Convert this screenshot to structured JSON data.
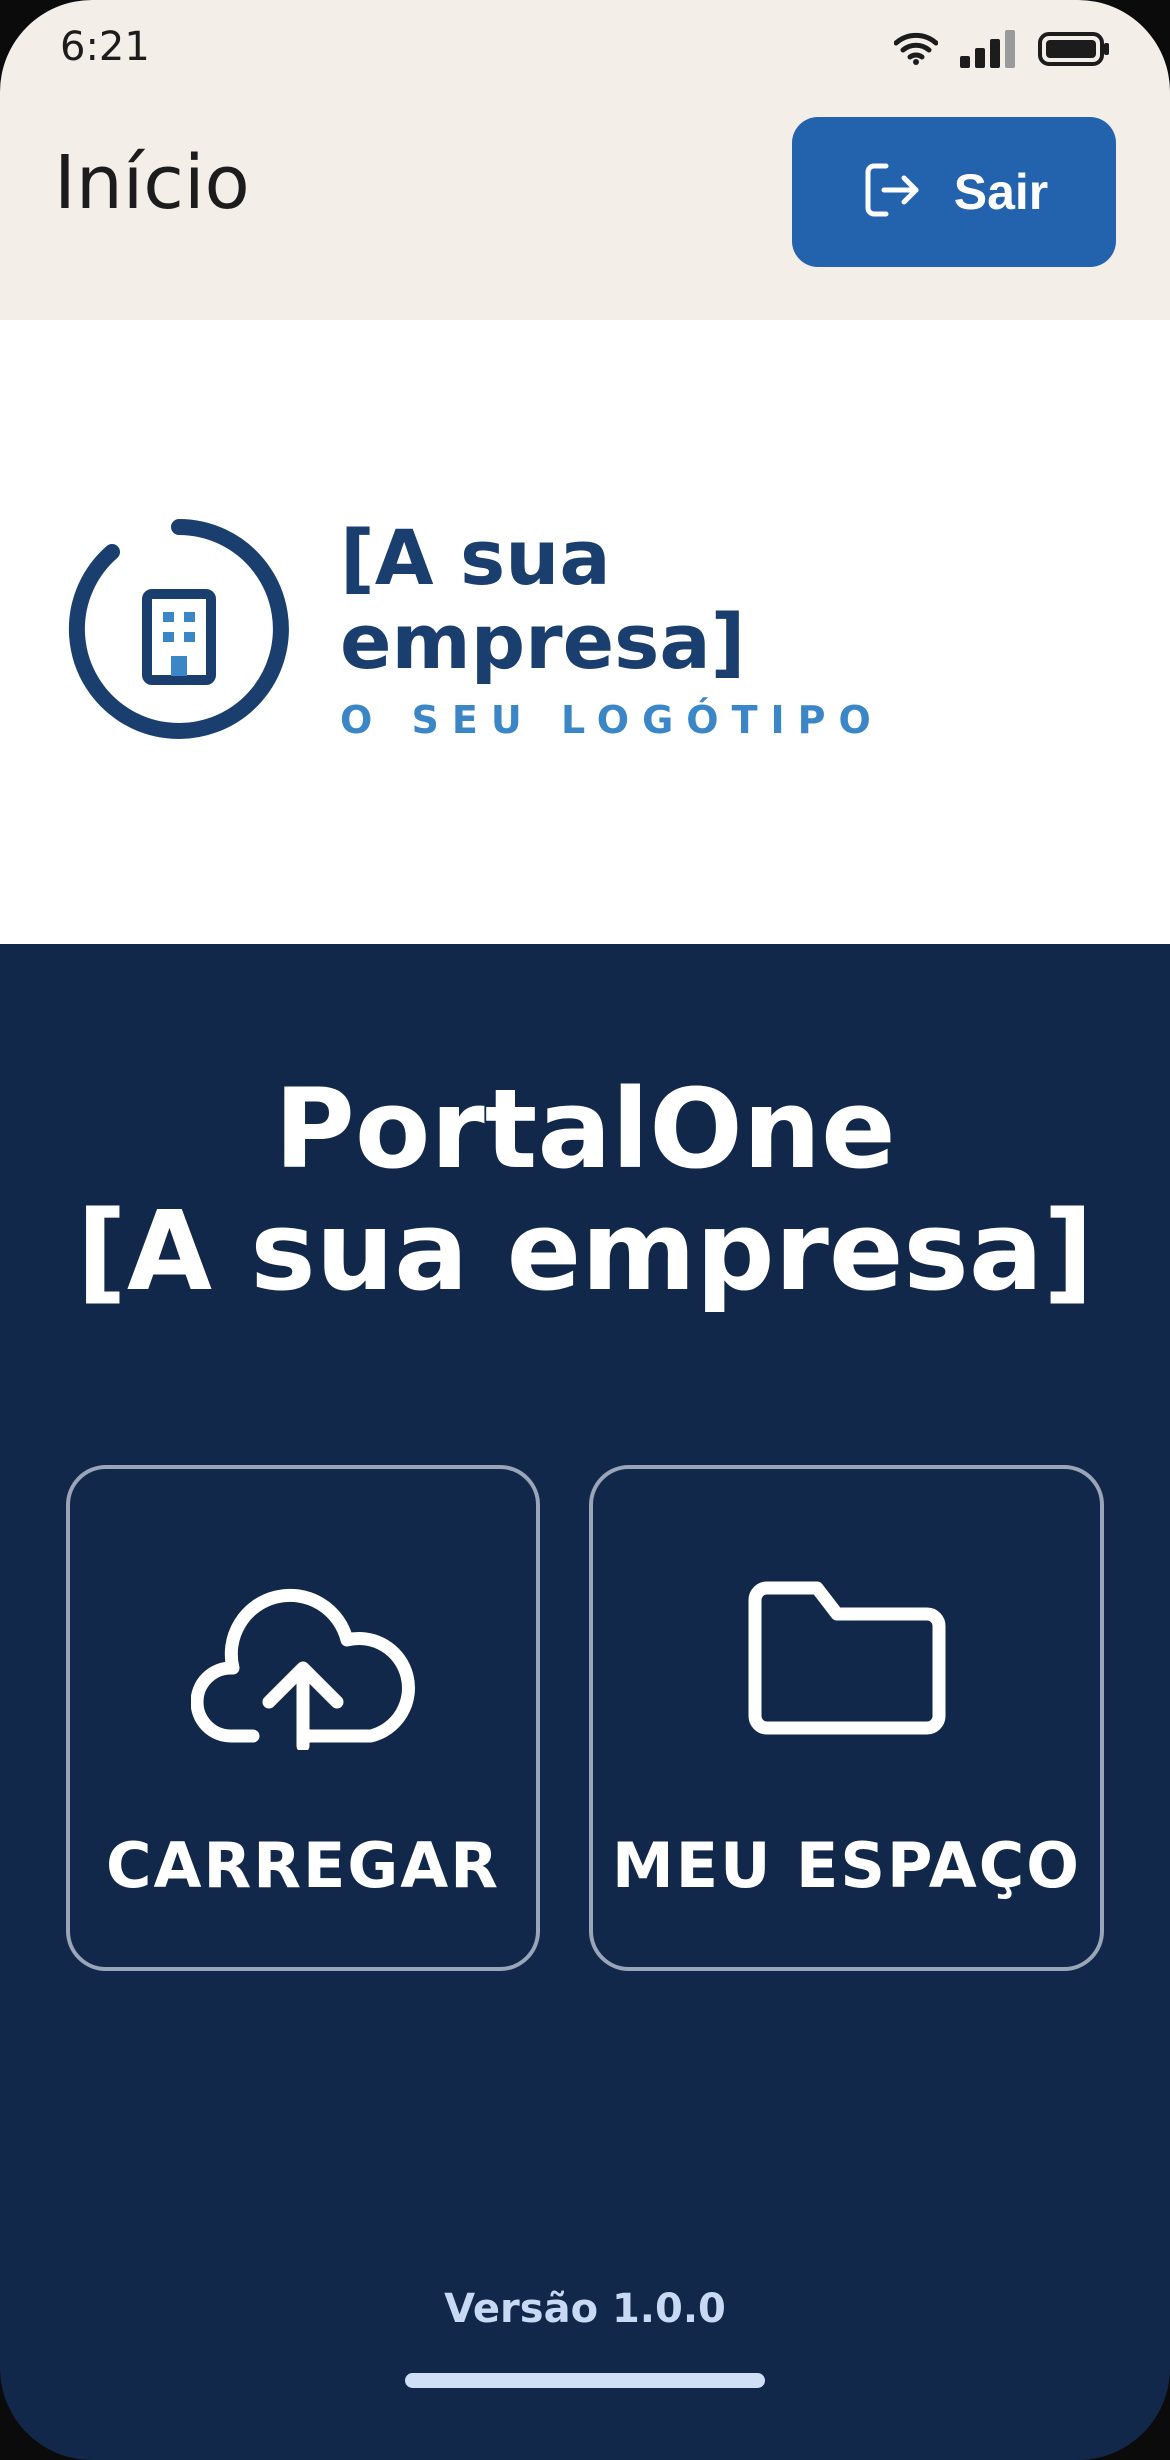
{
  "status_bar": {
    "time": "6:21",
    "icons": [
      "wifi-icon",
      "cellular-signal-icon",
      "battery-icon"
    ]
  },
  "header": {
    "title": "Início",
    "logout": {
      "label": "Sair",
      "icon": "logout-icon"
    }
  },
  "logo": {
    "company": "[A sua empresa]",
    "tagline": "O SEU LOGÓTIPO",
    "icon": "building-icon"
  },
  "main": {
    "title_line1": "PortalOne",
    "title_line2": "[A sua empresa]",
    "tiles": [
      {
        "label": "CARREGAR",
        "icon": "cloud-upload-icon"
      },
      {
        "label": "MEU ESPAÇO",
        "icon": "folder-icon"
      }
    ],
    "version": "Versão 1.0.0"
  },
  "colors": {
    "header_bg": "#f3eee8",
    "accent": "#2362ac",
    "navy": "#12284b",
    "logo_dark": "#1a3f6f",
    "logo_light": "#3b86c6"
  }
}
